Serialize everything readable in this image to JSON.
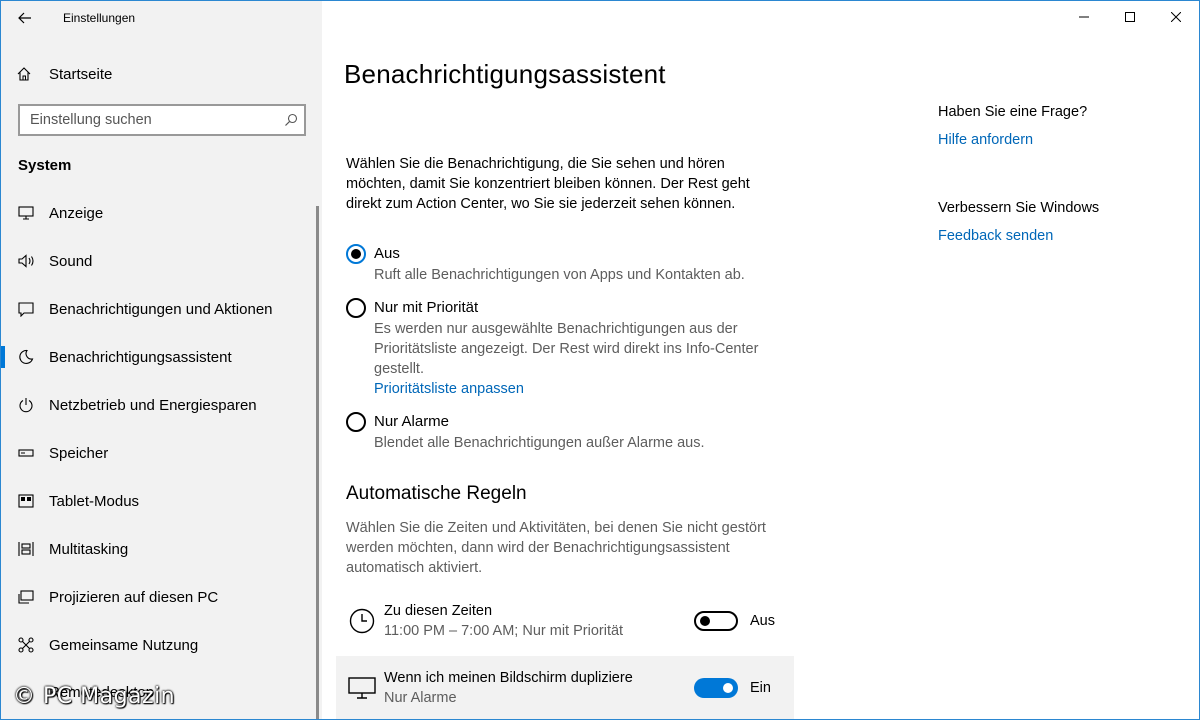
{
  "window": {
    "title": "Einstellungen",
    "back_icon": "arrow-left-icon",
    "caption_minimize": "—",
    "caption_maximize": "☐",
    "caption_close": "✕"
  },
  "sidebar": {
    "home_label": "Startseite",
    "search_placeholder": "Einstellung suchen",
    "section_title": "System",
    "items": [
      {
        "label": "Anzeige",
        "icon": "monitor-icon"
      },
      {
        "label": "Sound",
        "icon": "speaker-icon"
      },
      {
        "label": "Benachrichtigungen und Aktionen",
        "icon": "message-icon"
      },
      {
        "label": "Benachrichtigungsassistent",
        "icon": "moon-icon",
        "active": true
      },
      {
        "label": "Netzbetrieb und Energiesparen",
        "icon": "power-icon"
      },
      {
        "label": "Speicher",
        "icon": "storage-icon"
      },
      {
        "label": "Tablet-Modus",
        "icon": "tablet-icon"
      },
      {
        "label": "Multitasking",
        "icon": "multitasking-icon"
      },
      {
        "label": "Projizieren auf diesen PC",
        "icon": "project-icon"
      },
      {
        "label": "Gemeinsame Nutzung",
        "icon": "share-icon"
      }
    ],
    "partial_item_label": "Remotedesktop"
  },
  "main": {
    "title": "Benachrichtigungsassistent",
    "intro": "Wählen Sie die Benachrichtigung, die Sie sehen und hören möchten, damit Sie konzentriert bleiben können. Der Rest geht direkt zum Action Center, wo Sie sie jederzeit sehen können.",
    "options": [
      {
        "label": "Aus",
        "desc": "Ruft alle Benachrichtigungen von Apps und Kontakten ab.",
        "checked": true
      },
      {
        "label": "Nur mit Priorität",
        "desc": "Es werden nur ausgewählte Benachrichtigungen aus der Prioritätsliste angezeigt. Der Rest wird direkt ins Info-Center gestellt.",
        "link": "Prioritätsliste anpassen",
        "checked": false
      },
      {
        "label": "Nur Alarme",
        "desc": "Blendet alle Benachrichtigungen außer Alarme aus.",
        "checked": false
      }
    ],
    "rules_title": "Automatische Regeln",
    "rules_desc": "Wählen Sie die Zeiten und Aktivitäten, bei denen Sie nicht gestört werden möchten, dann wird der Benachrichtigungsassistent automatisch aktiviert.",
    "rules": [
      {
        "title": "Zu diesen Zeiten",
        "sub": "11:00 PM – 7:00 AM; Nur mit Priorität",
        "state": "Aus",
        "on": false,
        "icon": "clock-icon"
      },
      {
        "title": "Wenn ich meinen Bildschirm dupliziere",
        "sub": "Nur Alarme",
        "state": "Ein",
        "on": true,
        "icon": "monitor-icon"
      }
    ]
  },
  "help": {
    "question": "Haben Sie eine Frage?",
    "help_link": "Hilfe anfordern",
    "improve": "Verbessern Sie Windows",
    "feedback_link": "Feedback senden"
  },
  "watermark": "© PC Magazin",
  "colors": {
    "accent": "#0078d7",
    "link": "#0067b8",
    "sidebar_bg": "#f2f2f2"
  }
}
